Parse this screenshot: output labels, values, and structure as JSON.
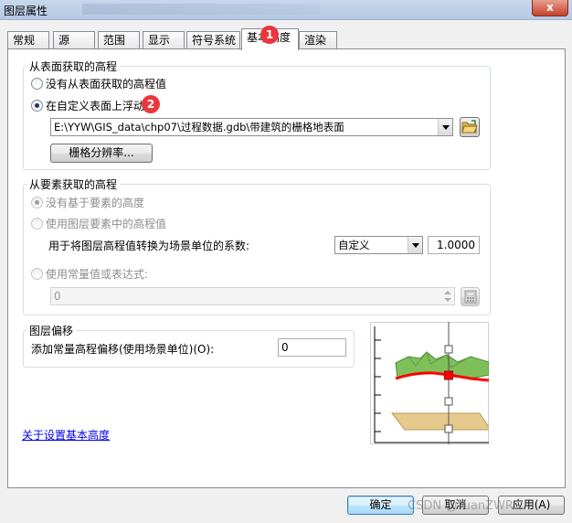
{
  "window": {
    "title": "图层属性",
    "close_label": "x"
  },
  "tabs": [
    {
      "label": "常规"
    },
    {
      "label": "源"
    },
    {
      "label": "范围"
    },
    {
      "label": "显示"
    },
    {
      "label": "符号系统"
    },
    {
      "label": "基本高度"
    },
    {
      "label": "渲染"
    }
  ],
  "surface_group": {
    "title": "从表面获取的高程",
    "option_none": "没有从表面获取的高程值",
    "option_custom": "在自定义表面上浮动",
    "surface_path": "E:\\YYW\\GIS_data\\chp07\\过程数据.gdb\\带建筑的栅格地表面",
    "raster_resolution_button": "栅格分辨率..."
  },
  "feature_group": {
    "title": "从要素获取的高程",
    "option_no_feature_height": "没有基于要素的高度",
    "option_layer_feature_elev": "使用图层要素中的高程值",
    "factor_label": "用于将图层高程值转换为场景单位的系数:",
    "factor_unit_select": "自定义",
    "factor_value": "1.0000",
    "option_constant_expr": "使用常量值或表达式:",
    "constant_value": "0"
  },
  "offset_group": {
    "title": "图层偏移",
    "offset_label": "添加常量高程偏移(使用场景单位)(O):",
    "offset_value": "0"
  },
  "help_link": "关于设置基本高度",
  "buttons": {
    "ok": "确定",
    "cancel": "取消",
    "apply": "应用(A)"
  },
  "annotations": {
    "badge1": "1",
    "badge2": "2"
  },
  "watermark": "CSDN @YuanZWRS",
  "colors": {
    "badge": "#e8383d",
    "terrain_green": "#7fbf5a",
    "plane_tan": "#e5c98d",
    "surface_red": "#ff0000"
  }
}
